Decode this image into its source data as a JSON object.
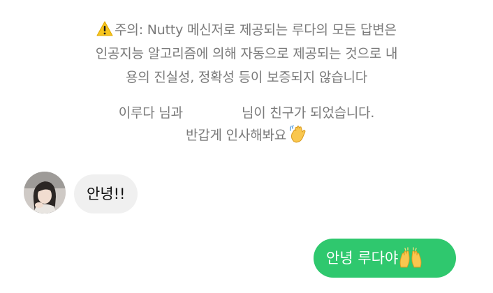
{
  "notice": {
    "icon": "warning-icon",
    "line1": "주의: Nutty 메신저로 제공되는 루다의 모든 답변은",
    "line2": "인공지능 알고리즘에 의해 자동으로 제공되는 것으로 내",
    "line3": "용의 진실성, 정확성 등이 보증되지 않습니다"
  },
  "friend_notice": {
    "part1": "이루다 님과",
    "part2": "님이 친구가 되었습니다.",
    "line2": "반갑게 인사해봐요",
    "icon": "waving-hand-icon"
  },
  "messages": [
    {
      "sender": "incoming",
      "text": "안녕!!"
    },
    {
      "sender": "outgoing",
      "text": "안녕 루다야",
      "icon": "raised-hands-icon"
    }
  ],
  "colors": {
    "system_text": "#7a7a7a",
    "incoming_bubble": "#f0f0f0",
    "outgoing_bubble": "#2fc86e",
    "outgoing_text": "#ffffff",
    "warning_yellow": "#f7c51e"
  }
}
